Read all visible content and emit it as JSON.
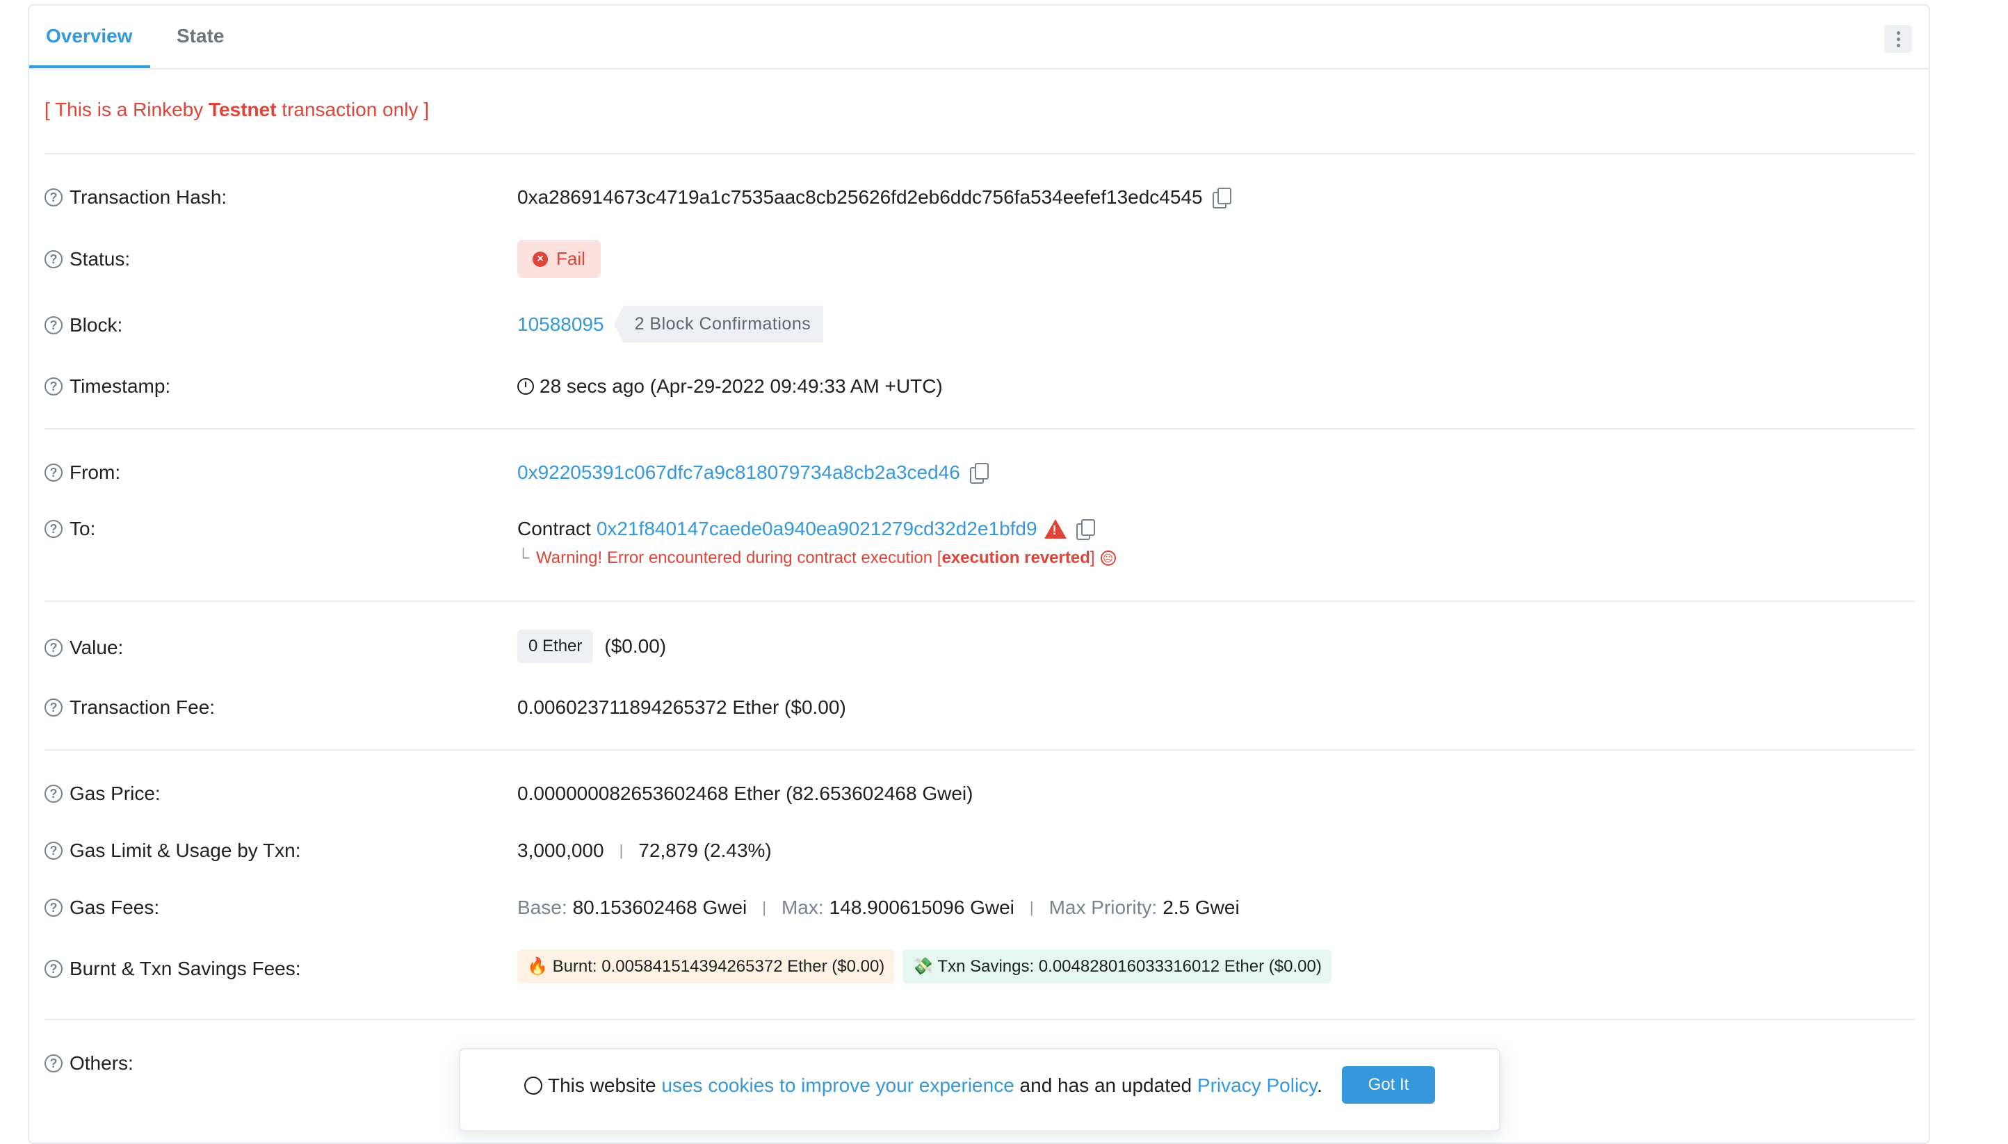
{
  "tabs": [
    {
      "label": "Overview",
      "active": true
    },
    {
      "label": "State",
      "active": false
    }
  ],
  "testnet_notice": {
    "prefix": "[ This is a Rinkeby ",
    "bold": "Testnet",
    "suffix": " transaction only ]"
  },
  "rows": {
    "tx_hash": {
      "label": "Transaction Hash:",
      "value": "0xa286914673c4719a1c7535aac8cb25626fd2eb6ddc756fa534eefef13edc4545"
    },
    "status": {
      "label": "Status:",
      "value": "Fail"
    },
    "block": {
      "label": "Block:",
      "value": "10588095",
      "confirmations": "2 Block Confirmations"
    },
    "timestamp": {
      "label": "Timestamp:",
      "value": "28 secs ago (Apr-29-2022 09:49:33 AM +UTC)"
    },
    "from": {
      "label": "From:",
      "value": "0x92205391c067dfc7a9c818079734a8cb2a3ced46"
    },
    "to": {
      "label": "To:",
      "prefix": "Contract ",
      "value": "0x21f840147caede0a940ea9021279cd32d2e1bfd9",
      "warning_prefix": "Warning! Error encountered during contract execution [",
      "warning_bold": "execution reverted",
      "warning_suffix": "]"
    },
    "value": {
      "label": "Value:",
      "chip": "0 Ether",
      "usd": "($0.00)"
    },
    "tx_fee": {
      "label": "Transaction Fee:",
      "value": "0.006023711894265372 Ether ($0.00)"
    },
    "gas_price": {
      "label": "Gas Price:",
      "value": "0.000000082653602468 Ether (82.653602468 Gwei)"
    },
    "gas_limit": {
      "label": "Gas Limit & Usage by Txn:",
      "limit": "3,000,000",
      "separator": "|",
      "usage": "72,879 (2.43%)"
    },
    "gas_fees": {
      "label": "Gas Fees:",
      "base_label": "Base:",
      "base_value": "80.153602468 Gwei",
      "max_label": "Max:",
      "max_value": "148.900615096 Gwei",
      "priority_label": "Max Priority:",
      "priority_value": "2.5 Gwei",
      "separator": "|"
    },
    "burnt": {
      "label": "Burnt & Txn Savings Fees:",
      "burnt_icon": "🔥",
      "burnt_text": "Burnt: 0.005841514394265372 Ether ($0.00)",
      "savings_icon": "💸",
      "savings_text": "Txn Savings: 0.004828016033316012 Ether ($0.00)"
    },
    "others": {
      "label": "Others:"
    }
  },
  "cookie_banner": {
    "text1": "This website ",
    "link1": "uses cookies to improve your experience",
    "text2": " and has an updated ",
    "link2": "Privacy Policy",
    "text3": ".",
    "button": "Got It"
  },
  "colors": {
    "accent": "#3498db",
    "danger": "#de4437",
    "muted": "#77838f"
  }
}
